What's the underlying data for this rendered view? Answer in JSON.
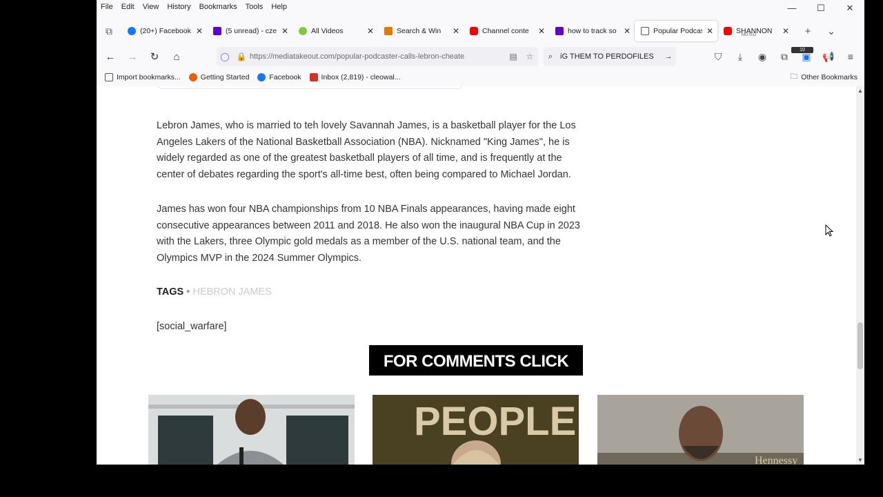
{
  "menubar": {
    "items": [
      "File",
      "Edit",
      "View",
      "History",
      "Bookmarks",
      "Tools",
      "Help"
    ]
  },
  "window_controls": {
    "minimize": "—",
    "maximize": "☐",
    "close": "✕"
  },
  "tabs": [
    {
      "label": "(20+) Facebook",
      "icon": "facebook-icon",
      "color": "#1877f2"
    },
    {
      "label": "(5 unread) - cze",
      "icon": "yahoo-mail-icon",
      "color": "#6001d2"
    },
    {
      "label": "All Videos",
      "icon": "rumble-icon",
      "color": "#85c742"
    },
    {
      "label": "Search & Win",
      "icon": "search-win-icon",
      "color": "#e07b00"
    },
    {
      "label": "Channel conte",
      "icon": "youtube-icon",
      "color": "#ff0000"
    },
    {
      "label": "how to track so",
      "icon": "yahoo-icon",
      "color": "#6001d2"
    },
    {
      "label": "Popular Podcas",
      "icon": "page-icon",
      "color": "#555555",
      "active": true
    },
    {
      "label": "SHANNON",
      "icon": "youtube-icon",
      "color": "#ff0000",
      "muted_label": "MUTED"
    }
  ],
  "tabbar": {
    "new_tab": "+",
    "list_all": "⌄",
    "tab_overview": "⧉"
  },
  "nav": {
    "back": "←",
    "forward": "→",
    "reload": "↻",
    "home": "⌂",
    "url": "https://mediatakeout.com/popular-podcaster-calls-lebron-cheate",
    "search_text": "iG THEM TO PERDOFILES",
    "search_go": "→"
  },
  "bookmarks": {
    "items": [
      {
        "label": "Import bookmarks...",
        "icon": "import-icon",
        "color": "#555555"
      },
      {
        "label": "Getting Started",
        "icon": "firefox-icon",
        "color": "#e66000"
      },
      {
        "label": "Facebook",
        "icon": "facebook-icon",
        "color": "#1877f2"
      },
      {
        "label": "Inbox (2,819) - cleowal...",
        "icon": "gmail-icon",
        "color": "#d93025"
      }
    ],
    "other": "Other Bookmarks"
  },
  "article": {
    "paragraph1": "Lebron James, who is married to teh lovely Savannah James, is a basketball player for the Los Angeles Lakers of the National Basketball Association (NBA). Nicknamed \"King James\", he is widely regarded as one of the greatest basketball players of all time, and is frequently at the center of debates regarding the sport's all-time best, often being compared to Michael Jordan.",
    "paragraph2": "James has won four NBA championships from 10 NBA Finals appearances, having made eight consecutive appearances between 2011 and 2018. He also won the inaugural NBA Cup in 2023 with the Lakers, three Olympic gold medals as a member of the U.S. national team, and the Olympics MVP in the 2024 Summer Olympics.",
    "tags_label": "TAGS",
    "tags_sep": " • ",
    "tag": "Hebron James",
    "shortcode": "[social_warfare]",
    "comments_button": "FOR COMMENTS CLICK HERE",
    "thumbnail_overlay_text": [
      "PEOPLE",
      "Hennessy"
    ]
  }
}
